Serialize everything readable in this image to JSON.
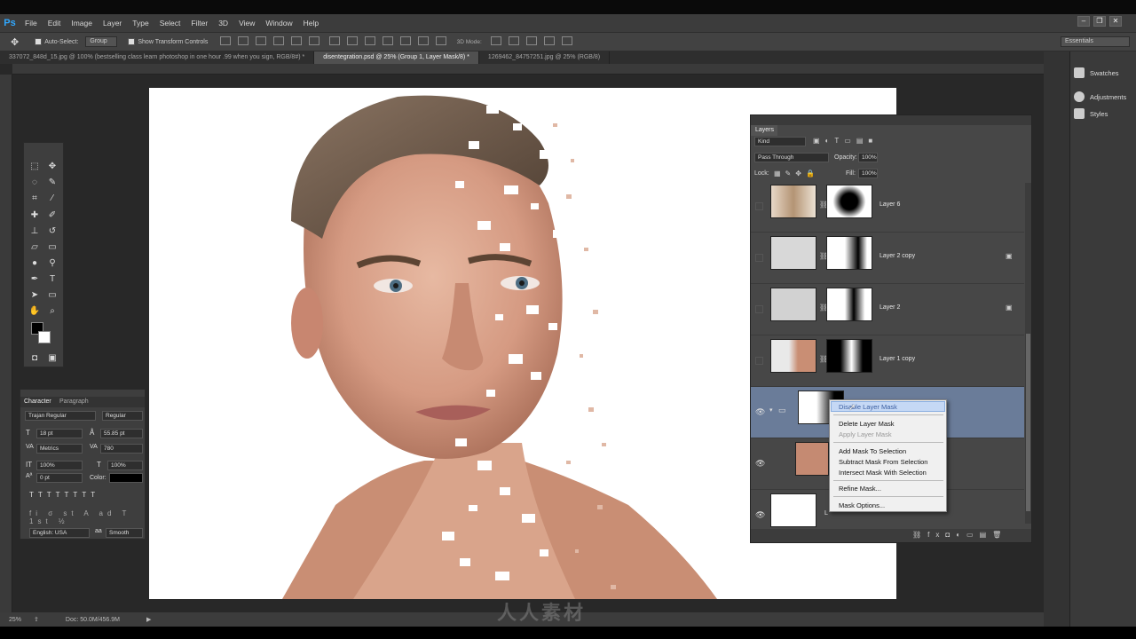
{
  "app": {
    "logo": "Ps"
  },
  "menu": [
    "File",
    "Edit",
    "Image",
    "Layer",
    "Type",
    "Select",
    "Filter",
    "3D",
    "View",
    "Window",
    "Help"
  ],
  "options_bar": {
    "auto_select_label": "Auto-Select:",
    "auto_select_value": "Group",
    "show_transform_label": "Show Transform Controls",
    "mode_label": "3D Mode:",
    "workspace": "Essentials"
  },
  "tabs": [
    {
      "label": "337072_848d_15.jpg @ 100% (bestselling class learn photoshop in one hour .99 when you sign, RGB/8#) *",
      "active": false
    },
    {
      "label": "disentegration.psd @ 25% (Group 1, Layer Mask/8) *",
      "active": true
    },
    {
      "label": "1269462_84757251.jpg @ 25% (RGB/8)",
      "active": false
    }
  ],
  "status": {
    "zoom": "25%",
    "doc": "Doc: 50.0M/456.9M"
  },
  "dock": {
    "swatches": "Swatches",
    "adjustments": "Adjustments",
    "styles": "Styles"
  },
  "character": {
    "tab_character": "Character",
    "tab_paragraph": "Paragraph",
    "font_family": "Trajan Regular",
    "font_style": "Regular",
    "size": "18 pt",
    "leading": "55.85 pt",
    "kerning": "Metrics",
    "tracking": "780",
    "vscale": "100%",
    "hscale": "100%",
    "baseline": "0 pt",
    "color_label": "Color:",
    "language": "English: USA",
    "antialias": "Smooth"
  },
  "layers": {
    "title": "Layers",
    "kind": "Kind",
    "blend": "Pass Through",
    "opacity_label": "Opacity:",
    "opacity": "100%",
    "lock_label": "Lock:",
    "fill_label": "Fill:",
    "fill": "100%",
    "rows": [
      {
        "name": "Layer 6",
        "visible": false
      },
      {
        "name": "Layer 2 copy",
        "visible": false
      },
      {
        "name": "Layer 2",
        "visible": false
      },
      {
        "name": "Layer 1 copy",
        "visible": false
      },
      {
        "name": "",
        "visible": true,
        "selected": true
      },
      {
        "name": "",
        "visible": true
      },
      {
        "name": "L",
        "visible": true
      }
    ]
  },
  "context_menu": {
    "items": [
      {
        "label": "Disable Layer Mask",
        "disabled": false,
        "highlight": true
      },
      {
        "label": "Delete Layer Mask",
        "disabled": false
      },
      {
        "label": "Apply Layer Mask",
        "disabled": true
      },
      {
        "label": "Add Mask To Selection",
        "disabled": false
      },
      {
        "label": "Subtract Mask From Selection",
        "disabled": false
      },
      {
        "label": "Intersect Mask With Selection",
        "disabled": false
      },
      {
        "label": "Refine Mask...",
        "disabled": false
      },
      {
        "label": "Mask Options...",
        "disabled": false
      }
    ]
  },
  "watermark": "人人素材",
  "colors": {
    "accent": "#31a8ff",
    "selection": "#6a7c99"
  }
}
